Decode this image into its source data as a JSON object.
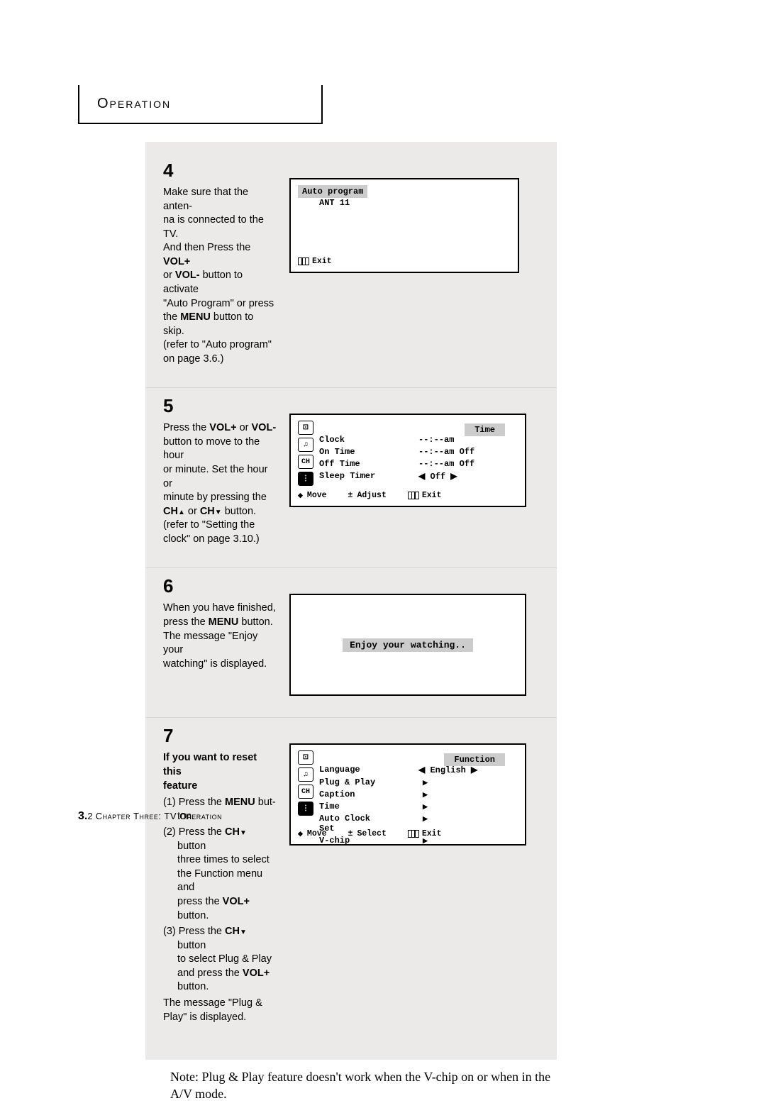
{
  "header": {
    "title": "Operation"
  },
  "steps": {
    "s4": {
      "num": "4",
      "p1": "Make sure that the anten-",
      "p2": "na is connected to the TV.",
      "p3": "And then Press the ",
      "p3b": "VOL+",
      "p4": "or ",
      "p4b": "VOL-",
      "p4c": " button to activate",
      "p5": "\"Auto Program\" or press",
      "p6": "the ",
      "p6b": "MENU",
      "p6c": " button  to skip.",
      "p7": "(refer to \"Auto program\"",
      "p8": "on page 3.6.)",
      "osd": {
        "title": "Auto program",
        "line1": "ANT  11",
        "exit": "Exit"
      }
    },
    "s5": {
      "num": "5",
      "p1": "Press the ",
      "p1b": "VOL+",
      "p1c": " or ",
      "p1d": "VOL-",
      "p2": "button to move to the hour",
      "p3": "or minute.  Set the hour or",
      "p4": "minute by pressing the",
      "p5a": "CH",
      "p5b": " or ",
      "p5c": "CH",
      "p5d": " button.",
      "p6": "(refer to \"Setting the",
      "p7": "clock\" on page 3.10.)",
      "osd": {
        "title": "Time",
        "rows": [
          {
            "label": "Clock",
            "val": "--:--am"
          },
          {
            "label": "On Time",
            "val": "--:--am Off"
          },
          {
            "label": "Off Time",
            "val": "--:--am Off"
          },
          {
            "label": "Sleep Timer",
            "val_left": "◀",
            "val_mid": "Off",
            "val_right": "▶"
          }
        ],
        "foot_move": "Move",
        "foot_mid": "Adjust",
        "foot_exit": "Exit"
      }
    },
    "s6": {
      "num": "6",
      "p1": "When you have finished,",
      "p2": "press the ",
      "p2b": "MENU",
      "p2c": " button.",
      "p3": "The message \"Enjoy your",
      "p4": "watching\" is displayed.",
      "osd": {
        "msg": "Enjoy your watching.."
      }
    },
    "s7": {
      "num": "7",
      "h1": "If you want to reset this",
      "h2": "feature",
      "l1a": "(1) Press the ",
      "l1b": "MENU",
      "l1c": " but-",
      "l1d": "ton.",
      "l2a": "(2) Press the ",
      "l2b": "CH",
      "l2c": " button",
      "l2d": "three times to select",
      "l2e": "the Function menu and",
      "l2f": "press the ",
      "l2g": "VOL+",
      "l2h": " button.",
      "l3a": "(3) Press the ",
      "l3b": "CH",
      "l3c": " button",
      "l3d": "to select Plug & Play",
      "l3e": "and press the ",
      "l3f": "VOL+",
      "l3g": "button.",
      "l4": "The message \"Plug &",
      "l5": "Play\" is displayed.",
      "osd": {
        "title": "Function",
        "rows": [
          {
            "label": "Language",
            "val": "English",
            "arrows": "both"
          },
          {
            "label": "Plug & Play",
            "arrows": "right"
          },
          {
            "label": "Caption",
            "arrows": "right"
          },
          {
            "label": "Time",
            "arrows": "right"
          },
          {
            "label": "Auto Clock Set",
            "arrows": "right"
          },
          {
            "label": "V-chip",
            "arrows": "right"
          }
        ],
        "foot_move": "Move",
        "foot_mid": "Select",
        "foot_exit": "Exit"
      }
    }
  },
  "note": "Note: Plug & Play feature doesn't work when the V-chip on or when in the A/V mode.",
  "footer": {
    "pnum": "3.",
    "pnum2": "2",
    "chapter": " Chapter Three:  TV Operation"
  }
}
